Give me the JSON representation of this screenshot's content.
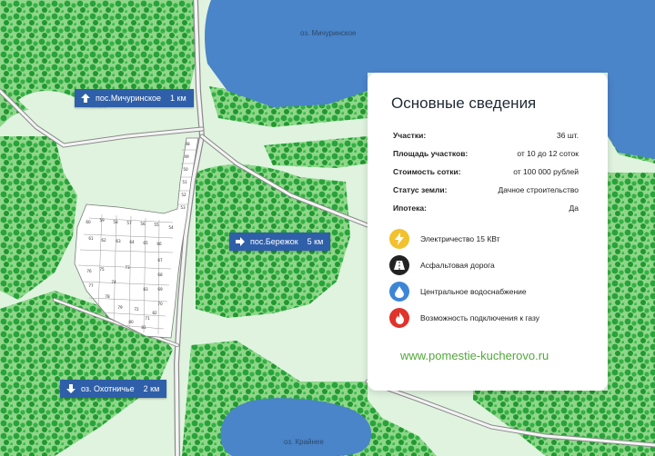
{
  "map": {
    "lakes": [
      {
        "name": "оз. Мичуринское"
      },
      {
        "name": "оз. Крайнее"
      }
    ],
    "signs": [
      {
        "text": "пос.Мичуринское",
        "distance": "1 км",
        "direction": "up"
      },
      {
        "text": "пос.Бережок",
        "distance": "5 км",
        "direction": "right"
      },
      {
        "text": "оз. Охотничье",
        "distance": "2 км",
        "direction": "down"
      }
    ],
    "plot_numbers": [
      "48",
      "49",
      "50",
      "51",
      "52",
      "53",
      "54",
      "55",
      "56",
      "57",
      "58",
      "59",
      "60",
      "61",
      "62",
      "63",
      "64",
      "65",
      "66",
      "67",
      "68",
      "69",
      "70",
      "71",
      "72",
      "73",
      "74",
      "75",
      "76",
      "77",
      "78",
      "79",
      "80",
      "81",
      "82",
      "83"
    ]
  },
  "info": {
    "title": "Основные сведения",
    "rows": [
      {
        "label": "Участки:",
        "value": "36 шт."
      },
      {
        "label": "Площадь участков:",
        "value": "от 10 до 12 соток"
      },
      {
        "label": "Стоимость сотки:",
        "value": "от 100 000 рублей"
      },
      {
        "label": "Статус земли:",
        "value": "Дачное строительство"
      },
      {
        "label": "Ипотека:",
        "value": "Да"
      }
    ],
    "features": [
      {
        "icon": "lightning-icon",
        "text": "Электричество 15 КВт",
        "color": "#f2c12e"
      },
      {
        "icon": "road-icon",
        "text": "Асфальтовая дорога",
        "color": "#222222"
      },
      {
        "icon": "water-drop-icon",
        "text": "Центральное водоснабжение",
        "color": "#3d86d6"
      },
      {
        "icon": "fire-icon",
        "text": "Возможность подключения к газу",
        "color": "#e0332c"
      }
    ],
    "website": "www.pomestie-kucherovo.ru"
  },
  "colors": {
    "accent": "#52a73b",
    "sign": "#2f5fa8",
    "lake": "#4a84c9",
    "forest": "#2fa43a",
    "meadow": "#dff3df"
  }
}
